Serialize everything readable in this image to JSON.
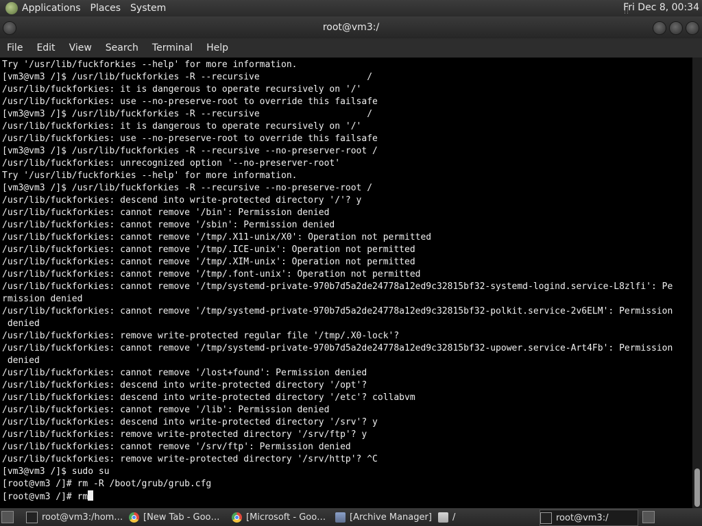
{
  "top_panel": {
    "menus": [
      "Applications",
      "Places",
      "System"
    ],
    "clock": "Fri Dec  8, 00:34"
  },
  "window": {
    "title": "root@vm3:/"
  },
  "menubar": {
    "items": [
      "File",
      "Edit",
      "View",
      "Search",
      "Terminal",
      "Help"
    ]
  },
  "terminal": {
    "lines": [
      "Try '/usr/lib/fuckforkies --help' for more information.",
      "[vm3@vm3 /]$ /usr/lib/fuckforkies -R --recursive                    /",
      "/usr/lib/fuckforkies: it is dangerous to operate recursively on '/'",
      "/usr/lib/fuckforkies: use --no-preserve-root to override this failsafe",
      "[vm3@vm3 /]$ /usr/lib/fuckforkies -R --recursive                    /",
      "/usr/lib/fuckforkies: it is dangerous to operate recursively on '/'",
      "/usr/lib/fuckforkies: use --no-preserve-root to override this failsafe",
      "[vm3@vm3 /]$ /usr/lib/fuckforkies -R --recursive --no-preserver-root /",
      "/usr/lib/fuckforkies: unrecognized option '--no-preserver-root'",
      "Try '/usr/lib/fuckforkies --help' for more information.",
      "[vm3@vm3 /]$ /usr/lib/fuckforkies -R --recursive --no-preserve-root /",
      "/usr/lib/fuckforkies: descend into write-protected directory '/'? y",
      "/usr/lib/fuckforkies: cannot remove '/bin': Permission denied",
      "/usr/lib/fuckforkies: cannot remove '/sbin': Permission denied",
      "/usr/lib/fuckforkies: cannot remove '/tmp/.X11-unix/X0': Operation not permitted",
      "/usr/lib/fuckforkies: cannot remove '/tmp/.ICE-unix': Operation not permitted",
      "/usr/lib/fuckforkies: cannot remove '/tmp/.XIM-unix': Operation not permitted",
      "/usr/lib/fuckforkies: cannot remove '/tmp/.font-unix': Operation not permitted",
      "/usr/lib/fuckforkies: cannot remove '/tmp/systemd-private-970b7d5a2de24778a12ed9c32815bf32-systemd-logind.service-L8zlfi': Pe",
      "rmission denied",
      "/usr/lib/fuckforkies: cannot remove '/tmp/systemd-private-970b7d5a2de24778a12ed9c32815bf32-polkit.service-2v6ELM': Permission",
      " denied",
      "/usr/lib/fuckforkies: remove write-protected regular file '/tmp/.X0-lock'?",
      "/usr/lib/fuckforkies: cannot remove '/tmp/systemd-private-970b7d5a2de24778a12ed9c32815bf32-upower.service-Art4Fb': Permission",
      " denied",
      "/usr/lib/fuckforkies: cannot remove '/lost+found': Permission denied",
      "/usr/lib/fuckforkies: descend into write-protected directory '/opt'?",
      "/usr/lib/fuckforkies: descend into write-protected directory '/etc'? collabvm",
      "/usr/lib/fuckforkies: cannot remove '/lib': Permission denied",
      "/usr/lib/fuckforkies: descend into write-protected directory '/srv'? y",
      "/usr/lib/fuckforkies: remove write-protected directory '/srv/ftp'? y",
      "/usr/lib/fuckforkies: cannot remove '/srv/ftp': Permission denied",
      "/usr/lib/fuckforkies: remove write-protected directory '/srv/http'? ^C",
      "[vm3@vm3 /]$ sudo su",
      "[root@vm3 /]# rm -R /boot/grub/grub.cfg"
    ],
    "prompt": "[root@vm3 /]# rm"
  },
  "taskbar": {
    "tasks": [
      {
        "label": "root@vm3:/hom…",
        "icon": "terminal-icon"
      },
      {
        "label": "[New Tab - Goo…",
        "icon": "chrome-icon"
      },
      {
        "label": "[Microsoft - Goo…",
        "icon": "chrome-icon"
      },
      {
        "label": "[Archive Manager]",
        "icon": "archive-manager-icon"
      },
      {
        "label": "/",
        "icon": "folder-icon"
      },
      {
        "label": "root@vm3:/",
        "icon": "terminal-icon"
      }
    ]
  }
}
